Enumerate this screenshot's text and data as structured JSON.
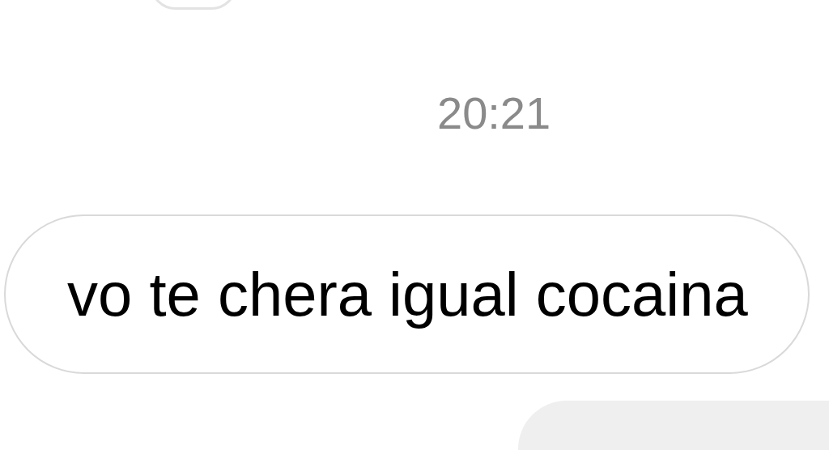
{
  "timestamp": "20:21",
  "messages": [
    {
      "text": "vo te chera igual cocaina",
      "kind": "incoming"
    }
  ]
}
